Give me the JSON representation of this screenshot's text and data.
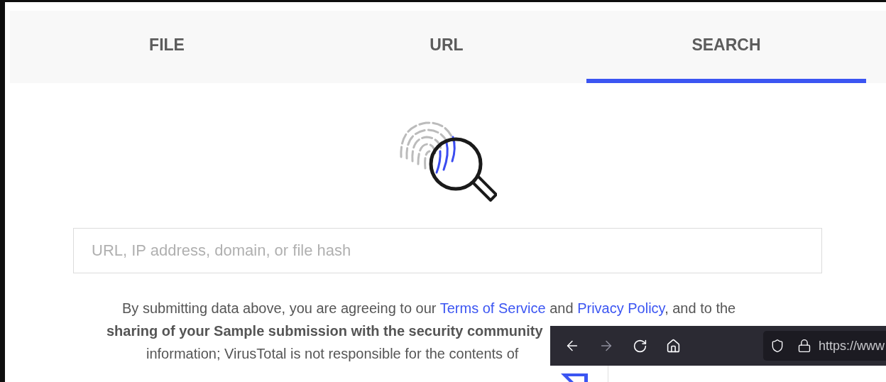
{
  "tabs": [
    {
      "label": "FILE",
      "selected": false
    },
    {
      "label": "URL",
      "selected": false
    },
    {
      "label": "SEARCH",
      "selected": true
    }
  ],
  "search": {
    "placeholder": "URL, IP address, domain, or file hash"
  },
  "notice": {
    "line_1": {
      "before": "By submitting data above, you are agreeing to our ",
      "link_1": "Terms of Service",
      "middle": " and ",
      "link_2": "Privacy Policy",
      "after": ", and to the"
    },
    "line_2": "sharing of your Sample submission with the security community",
    "line_3": "information; VirusTotal is not responsible for the contents of"
  },
  "browser_overlay": {
    "url": "https://www"
  }
}
